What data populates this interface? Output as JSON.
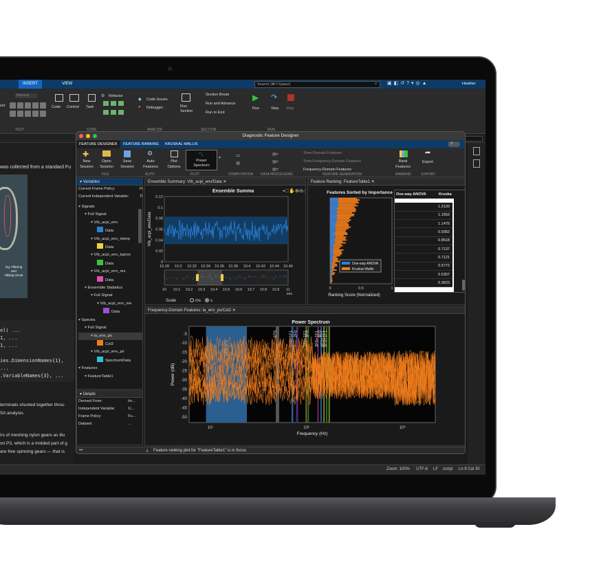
{
  "matlab": {
    "tabs": [
      "INSERT",
      "VIEW"
    ],
    "search_placeholder": "Search (⌘⇧Space)",
    "user": "Heather",
    "ribbon": {
      "normal": "Normal",
      "ext": "ext",
      "code": "Code",
      "control": "Control",
      "task": "Task",
      "refactor": "Refactor",
      "code_issues": "Code Issues",
      "debugger": "Debugger",
      "run_section": "Run Section",
      "section_break": "Section Break",
      "run_and_advance": "Run and Advance",
      "run_to_end": "Run to End",
      "run": "Run",
      "step": "Step",
      "stop": "Stop",
      "groups": [
        "TEXT",
        "CODE",
        "ANALYZE",
        "SECTION",
        "RUN"
      ]
    },
    "editor_lines": [
      "was collected from a standard Fu",
      "el( ...",
      "1, ...",
      "1, ...",
      "ies.DimensionNames{1}, ...",
      ".VariableNames{3}, ...",
      "terminals shunted together throu",
      "SA analysis.",
      "irs of meshing nylon gears as illu",
      "on P3, which is a molded part of g",
      " are free spinning gears — that is"
    ],
    "image_caption": [
      "ing, Filtering",
      "and",
      "ctifying circuit"
    ],
    "status": {
      "zoom": "Zoom: 100%",
      "encoding": "UTF-8",
      "eol": "LF",
      "mode": "script",
      "pos": "Ln 9  Col 30"
    }
  },
  "dfd": {
    "title": "Diagnostic Feature Designer",
    "tabs": [
      "FEATURE DESIGNER",
      "FEATURE RANKING",
      "KRUSKAL-WALLIS"
    ],
    "ribbon": {
      "new_session": [
        "New",
        "Session"
      ],
      "open_session": [
        "Open",
        "Session"
      ],
      "save_session": [
        "Save",
        "Session"
      ],
      "auto_features": [
        "Auto",
        "Features"
      ],
      "plot_options": [
        "Plot",
        "Options"
      ],
      "power_spectrum": [
        "Power",
        "Spectrum"
      ],
      "time_domain": "Time-Domain Features",
      "time_freq": "Time-Frequency-Domain Features",
      "freq_domain": "Frequency-Domain Features",
      "rank_features": [
        "Rank",
        "Features"
      ],
      "export": "Export",
      "groups": [
        "FILE",
        "AUTO",
        "PLOT",
        "COMPUTATION",
        "DATA PROCESSING",
        "FEATURE GENERATION",
        "RANKING",
        "EXPORT"
      ]
    },
    "variables": {
      "header": "Variables",
      "frame_policy_label": "Current Frame Policy:",
      "frame_policy_val": "Fi",
      "indep_var_label": "Current Independent Variable:",
      "indep_var_val": "Ti",
      "tree": [
        {
          "label": "Signals",
          "level": 0
        },
        {
          "label": "Full Signal",
          "level": 1
        },
        {
          "label": "Vib_acpi_env",
          "level": 2
        },
        {
          "label": "Data",
          "level": 3,
          "color": "#2b7fd6"
        },
        {
          "label": "Vib_acpi_env_interp",
          "level": 2
        },
        {
          "label": "Data",
          "level": 3,
          "color": "#f2d13a"
        },
        {
          "label": "Vib_acpi_env_tsproc",
          "level": 2
        },
        {
          "label": "Data",
          "level": 3,
          "color": "#3cc23c"
        },
        {
          "label": "Vib_acpi_env_res",
          "level": 2
        },
        {
          "label": "Data",
          "level": 3,
          "color": "#e04fb4"
        },
        {
          "label": "Ensemble Statistics",
          "level": 1
        },
        {
          "label": "Full Signal",
          "level": 2
        },
        {
          "label": "Vib_acpi_env_me",
          "level": 3
        },
        {
          "label": "Data",
          "level": 4,
          "color": "#9c4fd6"
        },
        {
          "label": "Spectra",
          "level": 0
        },
        {
          "label": "Full Signal",
          "level": 1
        },
        {
          "label": "la_env_ps",
          "level": 2,
          "selected": true
        },
        {
          "label": "Col2",
          "level": 3,
          "color": "#f07d1c"
        },
        {
          "label": "Vib_acpi_env_ps",
          "level": 2
        },
        {
          "label": "SpectrumData",
          "level": 3,
          "color": "#2bc3d6"
        },
        {
          "label": "Features",
          "level": 0
        },
        {
          "label": "FeatureTable1",
          "level": 1
        }
      ]
    },
    "details": {
      "header": "Details",
      "rows": [
        {
          "k": "Derived From:",
          "v": "Im..."
        },
        {
          "k": "Independent Variable:",
          "v": "1/..."
        },
        {
          "k": "Frame Policy:",
          "v": "Fu..."
        },
        {
          "k": "Dataset:",
          "v": "..."
        }
      ]
    },
    "ensemble": {
      "tab": "Ensemble Summary: Vib_acpi_env/Data",
      "title": "Ensemble Summa",
      "ylabel": "Vib_acpi_env/Data",
      "yticks": [
        "0.12",
        "0.1",
        "0.08",
        "0.06",
        "0.04",
        "0.02",
        "0"
      ],
      "xticks": [
        "10.28",
        "10.3",
        "10.32",
        "10.34",
        "10.36",
        "10.38",
        "10.4",
        "10.42",
        "10.44",
        "10.46"
      ],
      "xticks2": [
        "10",
        "10.1",
        "10.2",
        "10.3",
        "10.4",
        "10.5",
        "10.6",
        "10.7",
        "10.8",
        "10.9",
        "11"
      ],
      "xunit": "sec",
      "scale_label": "Scale",
      "unit_ms": "ms",
      "unit_s": "s"
    },
    "ranking": {
      "tab": "Feature Ranking: FeatureTable1",
      "title": "Features Sorted by Importance",
      "xlabel": "Ranking Score (Normalized)",
      "xticks": [
        "0",
        "0.5",
        "1"
      ],
      "legend": [
        "One-way ANOVA",
        "Kruskal-Wallis"
      ],
      "colors": {
        "anova": "#2f7fd8",
        "kruskal": "#f07d1c"
      },
      "table_headers": [
        "One-way ANOVA",
        "Kruska"
      ],
      "anova_values": [
        "1.2120",
        "1.1552",
        "1.1475",
        "0.9352",
        "0.8518",
        "0.7137",
        "0.7121",
        "0.5772",
        "0.5307",
        "0.3623"
      ]
    },
    "spectrum": {
      "tab": "Frequency-Domain Features: la_env_ps/Col2",
      "title": "Power Spectrum",
      "ylabel": "Power (dB)",
      "xlabel": "Frequency (Hz)",
      "yticks": [
        "-5",
        "-10",
        "-15",
        "-20",
        "-25",
        "-30",
        "-35",
        "-40",
        "-45",
        "-50"
      ],
      "xticks": [
        "10¹",
        "10²",
        "10³"
      ],
      "band_labels": [
        "1F0-1F1",
        "1F0",
        "1F0+1F1",
        "2F0",
        "2F0+1F1",
        "3F0",
        "3F0+1F1",
        "4F0",
        "4F0+1F1",
        "5F0+1F1"
      ]
    },
    "status": "Feature ranking plot for \"FeatureTable1\" is in focus.",
    "chart_data": [
      {
        "type": "line",
        "title": "Ensemble Summa",
        "ylabel": "Vib_acpi_env/Data",
        "xlabel": "sec",
        "xlim": [
          10.27,
          10.46
        ],
        "ylim": [
          0,
          0.13
        ],
        "series": [
          {
            "values": [
              0.066,
              0.058,
              0.07,
              0.062,
              0.055,
              0.068,
              0.064,
              0.059,
              0.071,
              0.06,
              0.063,
              0.057,
              0.069,
              0.061,
              0.066,
              0.058,
              0.064,
              0.07,
              0.056,
              0.062
            ]
          }
        ]
      },
      {
        "type": "bar",
        "title": "Features Sorted by Importance",
        "xlabel": "Ranking Score (Normalized)",
        "xlim": [
          0,
          1
        ],
        "series": [
          {
            "name": "One-way ANOVA",
            "values": [
              0.12,
              0.1,
              0.09,
              0.08,
              0.07,
              0.06,
              0.06,
              0.05,
              0.05,
              0.04
            ]
          },
          {
            "name": "Kruskal-Wallis",
            "values": [
              0.35,
              0.3,
              0.27,
              0.22,
              0.2,
              0.18,
              0.15,
              0.13,
              0.11,
              0.1
            ]
          }
        ]
      },
      {
        "type": "line",
        "title": "Power Spectrum",
        "xlabel": "Frequency (Hz)",
        "ylabel": "Power (dB)",
        "xscale": "log",
        "xlim": [
          6,
          2200
        ],
        "ylim": [
          -53,
          -1
        ],
        "series": [
          {
            "values": [
              -22,
              -25,
              -28,
              -30,
              -27,
              -24,
              -20,
              -25,
              -15,
              -22,
              -18,
              -12,
              -20,
              -25,
              -15,
              -10,
              -18,
              -22,
              -12,
              -20
            ]
          }
        ]
      }
    ]
  }
}
